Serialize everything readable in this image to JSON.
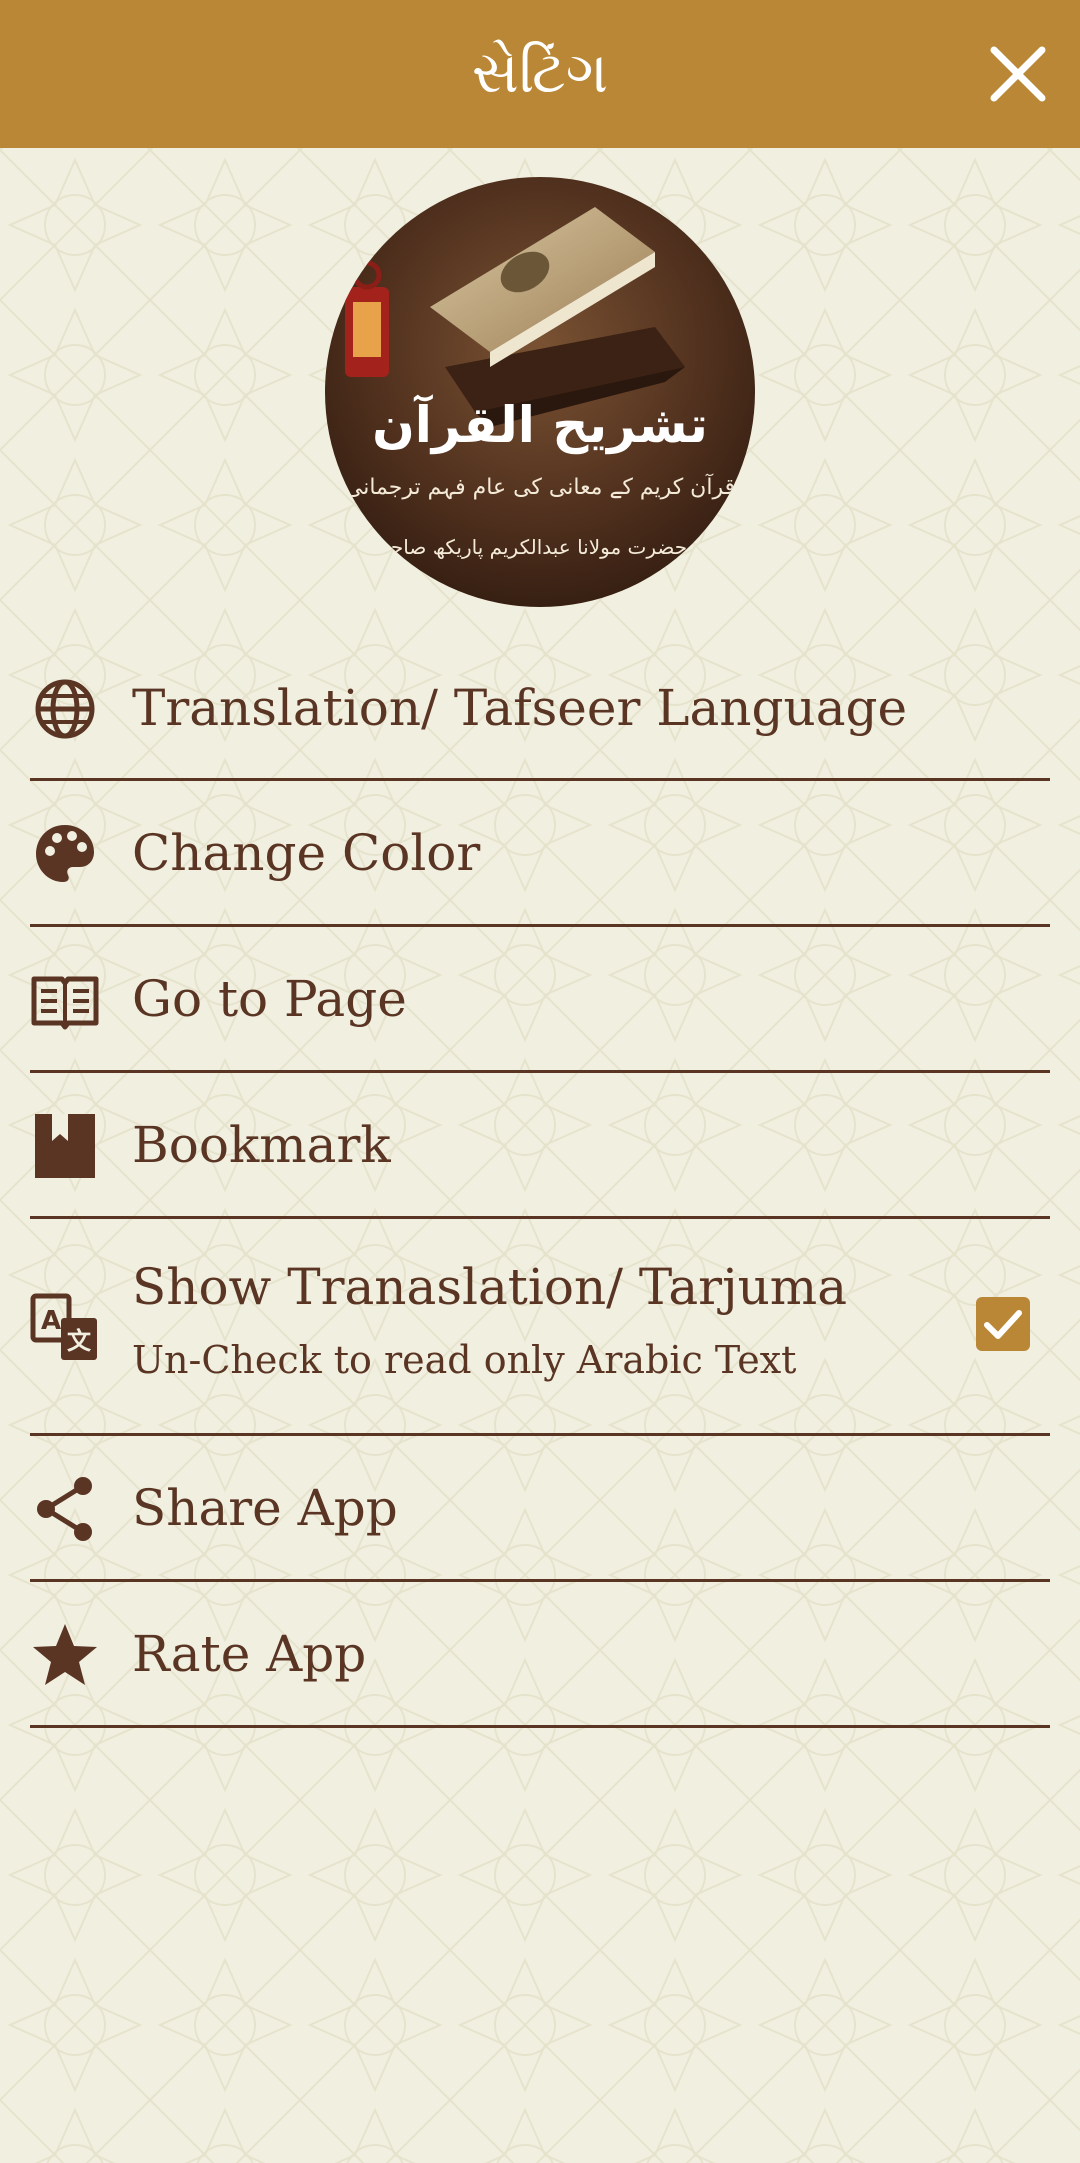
{
  "header": {
    "title": "સેટિંગ",
    "close_icon": "close-icon"
  },
  "logo": {
    "title": "تشریح القرآن",
    "subtitle": "قرآن کریم کے معانی کی عام فہم ترجمانی",
    "author": "از حضرت مولانا عبدالکریم پاریکھ صاحب"
  },
  "menu": {
    "items": [
      {
        "label": "Translation/ Tafseer Language",
        "icon": "globe-icon"
      },
      {
        "label": "Change Color",
        "icon": "palette-icon"
      },
      {
        "label": "Go to Page",
        "icon": "open-book-icon"
      },
      {
        "label": "Bookmark",
        "icon": "bookmark-icon"
      },
      {
        "label": "Show Tranaslation/ Tarjuma",
        "sublabel": "Un-Check to read only Arabic Text",
        "icon": "translate-icon",
        "checked": true
      },
      {
        "label": "Share App",
        "icon": "share-icon"
      },
      {
        "label": "Rate App",
        "icon": "star-icon"
      }
    ]
  },
  "colors": {
    "header_bg": "#b98735",
    "page_bg": "#f1efe0",
    "text": "#5a3524",
    "checkbox": "#b98735"
  }
}
